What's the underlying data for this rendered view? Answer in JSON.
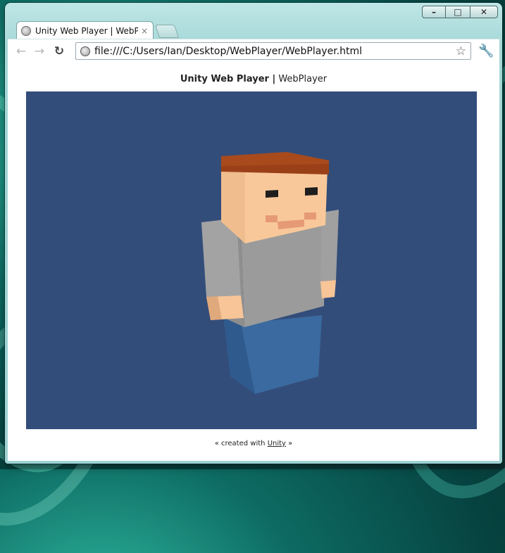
{
  "browser": {
    "tab": {
      "title": "Unity Web Player | WebPlayer",
      "close": "×"
    },
    "controls": {
      "minimize": "–",
      "maximize": "□",
      "close": "✕"
    },
    "nav": {
      "back": "←",
      "forward": "→",
      "reload": "↻"
    },
    "address": {
      "url": "file:///C:/Users/Ian/Desktop/WebPlayer/WebPlayer.html",
      "star": "☆"
    },
    "menu": "🔧"
  },
  "page": {
    "heading_bold": "Unity Web Player |",
    "heading_rest": "WebPlayer",
    "footer_prefix": "« created with",
    "footer_link": "Unity",
    "footer_suffix": "»"
  },
  "colors": {
    "player_background": "#334d7a",
    "hair": "#a84a1c",
    "skin": "#f9c89a",
    "shirt": "#9b9b9b",
    "pants": "#3a6aa0"
  }
}
